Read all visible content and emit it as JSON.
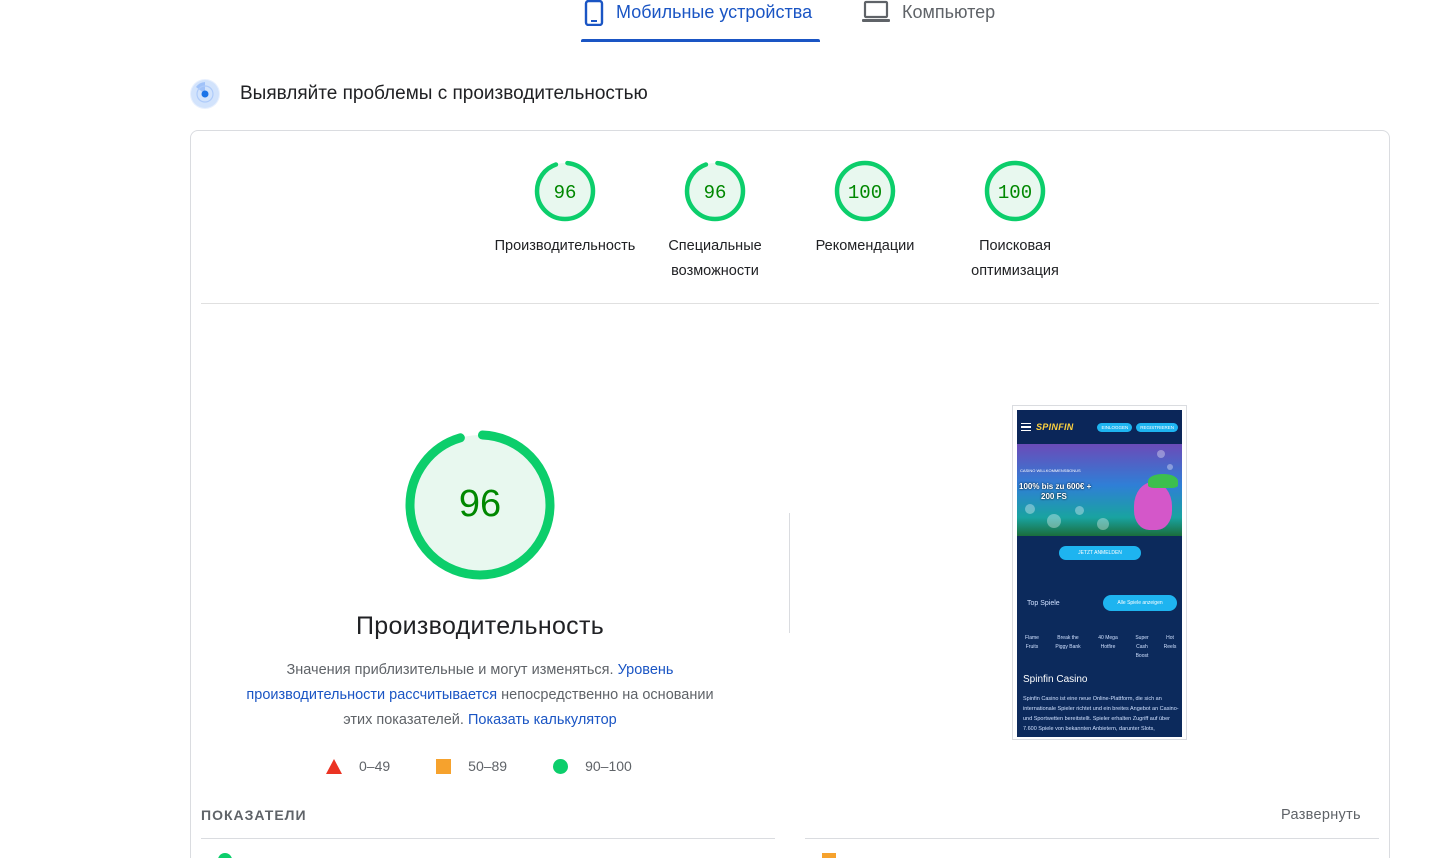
{
  "tabs": {
    "mobile_label": "Мобильные устройства",
    "desktop_label": "Компьютер",
    "active": "mobile",
    "accent_color": "#1a55c4"
  },
  "section": {
    "title": "Выявляйте проблемы с производительностью",
    "icon": "lighthouse-radar-icon"
  },
  "scores": [
    {
      "value": "96",
      "label": "Производительность",
      "score": 96
    },
    {
      "value": "96",
      "label": "Специальные возможности",
      "score": 96
    },
    {
      "value": "100",
      "label": "Рекомендации",
      "score": 100
    },
    {
      "value": "100",
      "label": "Поисковая оптимизация",
      "score": 100
    }
  ],
  "performance": {
    "score": "96",
    "score_value": 96,
    "title": "Производительность",
    "desc_text1": "Значения приблизительные и могут изменяться. ",
    "desc_link1": "Уровень производительности рассчитывается",
    "desc_text2": " непосредственно на основании этих показателей. ",
    "desc_link2": "Показать калькулятор"
  },
  "legend": [
    {
      "range": "0–49",
      "shape": "triangle",
      "color": "#eb3323"
    },
    {
      "range": "50–89",
      "shape": "square",
      "color": "#f6a22d"
    },
    {
      "range": "90–100",
      "shape": "circle",
      "color": "#0cce6b"
    }
  ],
  "colors": {
    "pass": "#0cce6b",
    "pass_text": "#008800",
    "pass_fill": "#e8f8ef",
    "link": "#1a55c4"
  },
  "screenshot": {
    "logo": "SPINFIN",
    "login_btn": "EINLOGGEN",
    "register_btn": "REGISTRIEREN",
    "hero_small": "CASINO WILLKOMMENSBONUS",
    "hero_line1": "100% bis zu 600€ +",
    "hero_line2": "200 FS",
    "cta": "JETZT ANMELDEN",
    "top_games": "Top Spiele",
    "all_games_btn": "Alle Spiele anzeigen",
    "games": [
      "Flame Fruits",
      "Break the Piggy Bank",
      "40 Mega Hotfire",
      "Super Cash Boost",
      "Hot Reels"
    ],
    "heading": "Spinfin Casino",
    "paragraph": "Spinfin Casino ist eine neue Online-Plattform, die sich an internationale Spieler richtet und ein breites Angebot an Casino- und Sportwetten bereitstellt. Spieler erhalten Zugriff auf über 7.600 Spiele von bekannten Anbietern, darunter Slots,"
  },
  "metrics": {
    "label": "ПОКАЗАТЕЛИ",
    "expand": "Развернуть"
  }
}
